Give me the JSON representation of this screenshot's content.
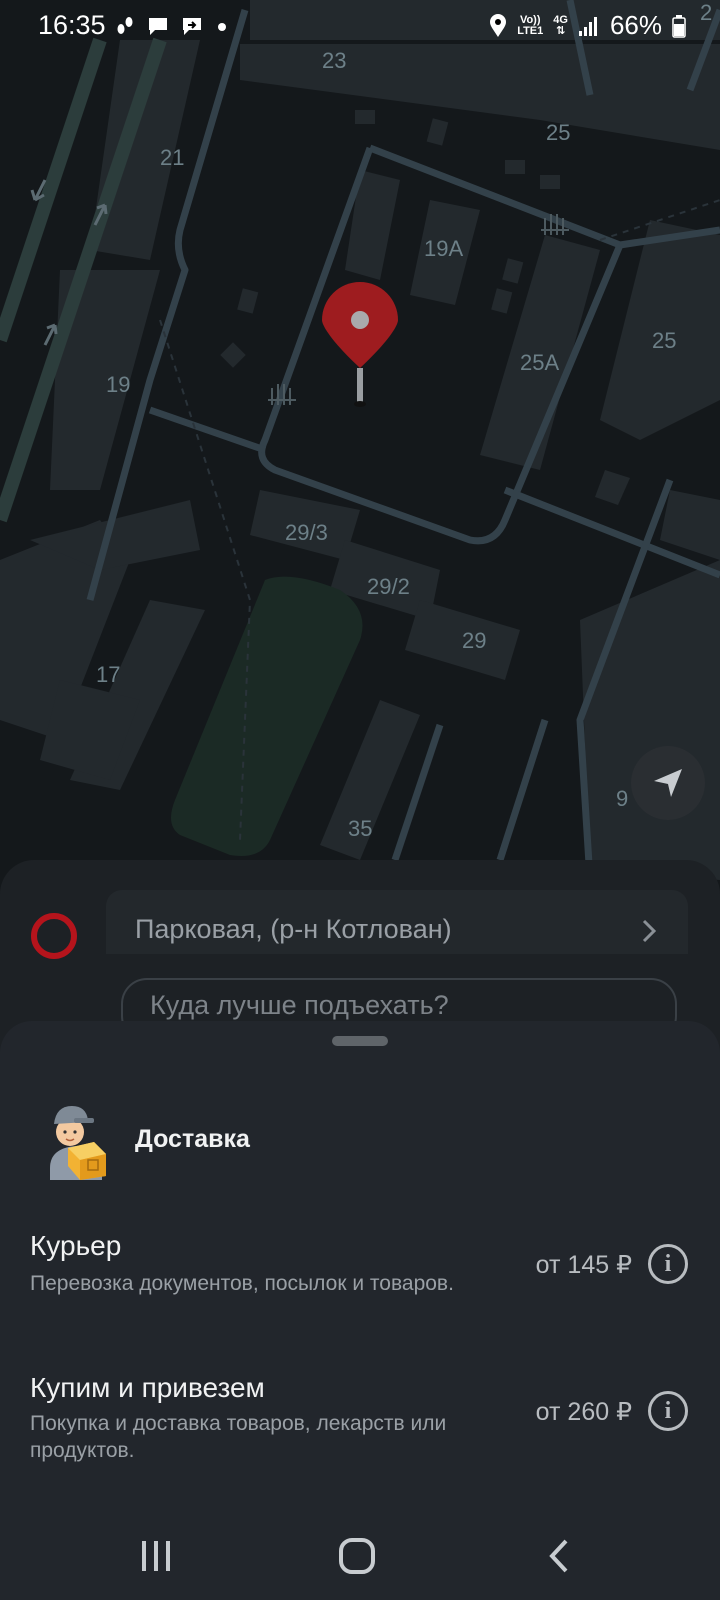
{
  "status_bar": {
    "time": "16:35",
    "left_icons": [
      "steps-icon",
      "message-icon",
      "forward-message-icon",
      "dot-icon"
    ],
    "network_label_1": "Vo))",
    "network_label_2": "LTE1",
    "network_type": "4G",
    "battery_text": "66%"
  },
  "map": {
    "labels": [
      "23",
      "25",
      "21",
      "19А",
      "25",
      "25А",
      "19",
      "29/3",
      "29/2",
      "29",
      "17",
      "9",
      "35",
      "2"
    ],
    "pin_color": "#9e1c1f"
  },
  "route": {
    "from": "Парковая, (р-н Котлован)",
    "hint": "Куда лучше подъехать?"
  },
  "sheet": {
    "category_title": "Доставка",
    "options": [
      {
        "title": "Курьер",
        "description": "Перевозка документов, посылок и товаров.",
        "price": "от 145 ₽",
        "info": "i"
      },
      {
        "title": "Купим и привезем",
        "description": "Покупка и доставка товаров, лекарств или продуктов.",
        "price": "от 260 ₽",
        "info": "i"
      }
    ]
  },
  "colors": {
    "accent_red": "#b5141c",
    "sheet_bg": "#22262c",
    "map_bg": "#14181b"
  }
}
